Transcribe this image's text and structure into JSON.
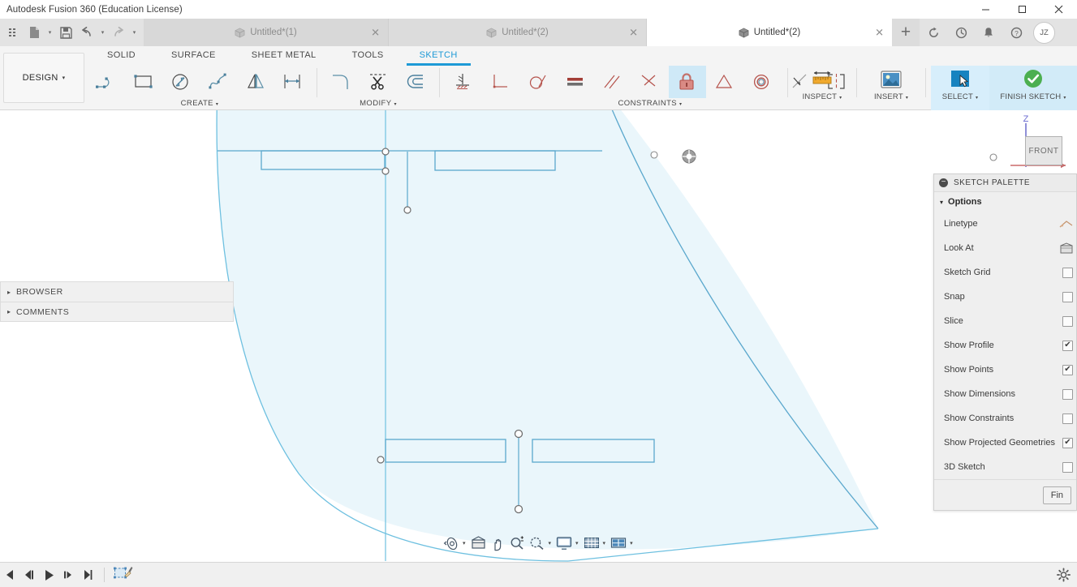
{
  "window": {
    "title": "Autodesk Fusion 360 (Education License)",
    "controls": {
      "minimize": "—",
      "maximize": "❐",
      "close": "✕"
    }
  },
  "quick_access": {
    "items": [
      {
        "name": "app-grid-icon",
        "label": ""
      },
      {
        "name": "new-file-icon",
        "label": ""
      },
      {
        "name": "save-icon",
        "label": ""
      },
      {
        "name": "undo-icon",
        "label": ""
      },
      {
        "name": "redo-icon",
        "label": ""
      }
    ]
  },
  "tabs": [
    {
      "label": "Untitled*(1)",
      "close": "✕",
      "active": false
    },
    {
      "label": "Untitled*(2)",
      "close": "✕",
      "active": false
    },
    {
      "label": "Untitled*(2)",
      "close": "✕",
      "active": true
    }
  ],
  "tab_actions": {
    "add": "+",
    "icons": [
      "refresh-icon",
      "recent-icon",
      "notifications-icon",
      "help-icon"
    ],
    "avatar_initials": "JZ"
  },
  "ribbon": {
    "workspace": {
      "label": "DESIGN",
      "caret": "▾"
    },
    "tabs": [
      {
        "label": "SOLID",
        "active": false
      },
      {
        "label": "SURFACE",
        "active": false
      },
      {
        "label": "SHEET METAL",
        "active": false
      },
      {
        "label": "TOOLS",
        "active": false
      },
      {
        "label": "SKETCH",
        "active": true
      }
    ],
    "groups": [
      {
        "label": "CREATE",
        "caret": "▾",
        "tools": [
          "line-icon",
          "rectangle-icon",
          "circle-icon",
          "spline-icon",
          "mirror-icon",
          "dimension-icon"
        ]
      },
      {
        "label": "MODIFY",
        "caret": "▾",
        "tools": [
          "fillet-icon",
          "trim-icon",
          "offset-icon"
        ]
      },
      {
        "label": "CONSTRAINTS",
        "caret": "▾",
        "tools": [
          "horizontal-vertical-icon",
          "perpendicular-icon",
          "tangent-icon",
          "equal-icon",
          "parallel-icon",
          "coincident-icon",
          "fix-lock-icon",
          "midpoint-icon",
          "concentric-icon",
          "collinear-icon",
          "symmetry-icon"
        ]
      }
    ],
    "right_groups": [
      {
        "label": "INSPECT",
        "caret": "▾",
        "icon": "measure-icon"
      },
      {
        "label": "INSERT",
        "caret": "▾",
        "icon": "insert-image-icon"
      },
      {
        "label": "SELECT",
        "caret": "▾",
        "icon": "select-cursor-icon"
      },
      {
        "label": "FINISH SKETCH",
        "caret": "▾",
        "icon": "finish-sketch-check-icon"
      }
    ]
  },
  "left_panels": [
    {
      "label": "BROWSER",
      "triangle": "▸"
    },
    {
      "label": "COMMENTS",
      "triangle": "▸"
    }
  ],
  "sketch_palette": {
    "title": "SKETCH PALETTE",
    "collapse_glyph": "−",
    "section": {
      "label": "Options",
      "triangle": "▾"
    },
    "rows": [
      {
        "label": "Linetype",
        "control": "linetype-icon",
        "checked": null
      },
      {
        "label": "Look At",
        "control": "look-at-icon",
        "checked": null
      },
      {
        "label": "Sketch Grid",
        "control": "checkbox",
        "checked": false
      },
      {
        "label": "Snap",
        "control": "checkbox",
        "checked": false
      },
      {
        "label": "Slice",
        "control": "checkbox",
        "checked": false
      },
      {
        "label": "Show Profile",
        "control": "checkbox",
        "checked": true
      },
      {
        "label": "Show Points",
        "control": "checkbox",
        "checked": true
      },
      {
        "label": "Show Dimensions",
        "control": "checkbox",
        "checked": false
      },
      {
        "label": "Show Constraints",
        "control": "checkbox",
        "checked": false
      },
      {
        "label": "Show Projected Geometries",
        "control": "checkbox",
        "checked": true
      },
      {
        "label": "3D Sketch",
        "control": "checkbox",
        "checked": false
      }
    ],
    "footer_button": "Fin"
  },
  "view_cube": {
    "face_label": "FRONT",
    "axis_z": "Z"
  },
  "nav_bar": {
    "items": [
      {
        "name": "orbit-icon",
        "caret": "▾"
      },
      {
        "name": "look-at-icon",
        "caret": ""
      },
      {
        "name": "pan-icon",
        "caret": ""
      },
      {
        "name": "zoom-icon",
        "caret": ""
      },
      {
        "name": "zoom-window-icon",
        "caret": "▾"
      },
      {
        "name": "display-settings-icon",
        "caret": "▾"
      },
      {
        "name": "grid-settings-icon",
        "caret": "▾"
      },
      {
        "name": "viewports-icon",
        "caret": "▾"
      }
    ]
  },
  "timeline": {
    "controls": [
      {
        "name": "go-to-beginning-icon",
        "glyph": "◀"
      },
      {
        "name": "step-back-icon",
        "glyph": "◀❘"
      },
      {
        "name": "play-icon",
        "glyph": "▶"
      },
      {
        "name": "step-forward-icon",
        "glyph": "❘▶"
      },
      {
        "name": "go-to-end-icon",
        "glyph": "▶❘"
      }
    ],
    "feature": {
      "name": "sketch-feature-icon"
    },
    "settings": {
      "name": "timeline-settings-gear-icon"
    }
  },
  "colors": {
    "accent_blue": "#1e9ad6",
    "sketch_line": "#5ba8cd",
    "sketch_fill": "#eaf6fb",
    "finish_green": "#4caf50",
    "constraint_red": "#c4726c",
    "panel_bg": "#efefef",
    "ribbon_bg": "#f4f4f4"
  }
}
